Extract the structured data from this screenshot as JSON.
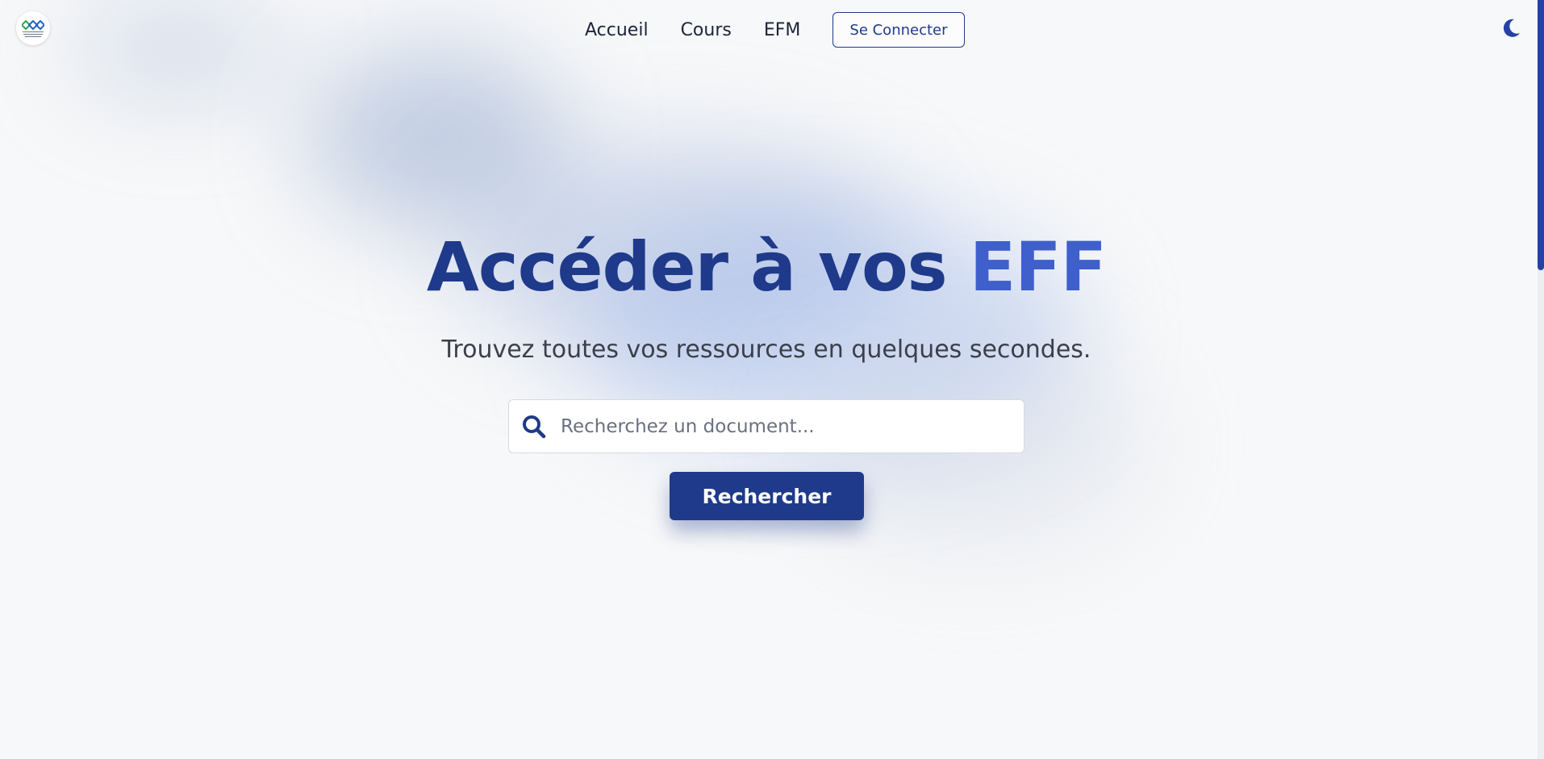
{
  "nav": {
    "home_label": "Accueil",
    "courses_label": "Cours",
    "efm_label": "EFM",
    "connect_label": "Se Connecter"
  },
  "hero": {
    "title_main": "Accéder à vos",
    "title_accent": "EFF",
    "subtitle": "Trouvez toutes vos ressources en quelques secondes."
  },
  "search": {
    "placeholder": "Recherchez un document...",
    "button_label": "Rechercher"
  },
  "icons": {
    "logo": "institution-logo",
    "theme_toggle": "moon-icon",
    "search": "search-icon"
  },
  "colors": {
    "primary": "#1f3a8a",
    "accent": "#3f5fcc",
    "background": "#f7f8f9"
  }
}
